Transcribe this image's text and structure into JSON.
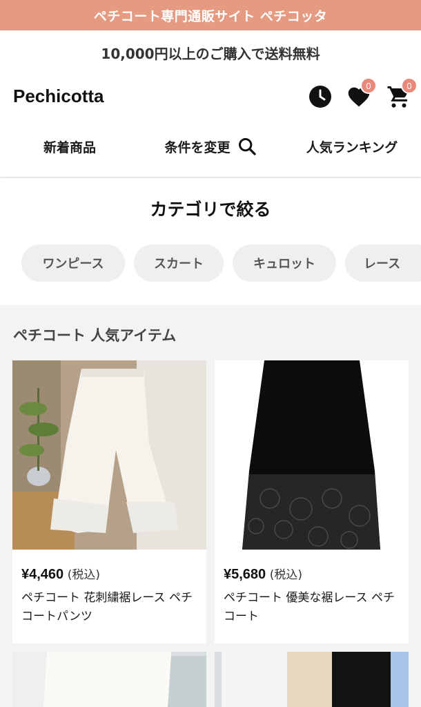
{
  "banner": {
    "text": "ペチコート専門通販サイト ペチコッタ"
  },
  "header": {
    "shipping_notice": "10,000円以上のご購入で送料無料",
    "logo": "Pechicotta",
    "favorites_count": "0",
    "cart_count": "0",
    "icons": [
      "clock-icon",
      "heart-icon",
      "cart-icon",
      "search-icon"
    ]
  },
  "nav": {
    "new_items": "新着商品",
    "change_conditions": "条件を変更",
    "ranking": "人気ランキング"
  },
  "categories": {
    "title": "カテゴリで絞る",
    "chips": [
      "ワンピース",
      "スカート",
      "キュロット",
      "レース"
    ]
  },
  "popular": {
    "title": "ペチコート 人気アイテム",
    "products": [
      {
        "price": "¥4,460",
        "tax": "(税込)",
        "name": "ペチコート 花刺繍裾レース ペチコートパンツ"
      },
      {
        "price": "¥5,680",
        "tax": "(税込)",
        "name": "ペチコート 優美な裾レース ペチコート"
      }
    ]
  },
  "colors": {
    "banner": "#e59a82",
    "badge": "#e8897a",
    "chip": "#efefef"
  }
}
